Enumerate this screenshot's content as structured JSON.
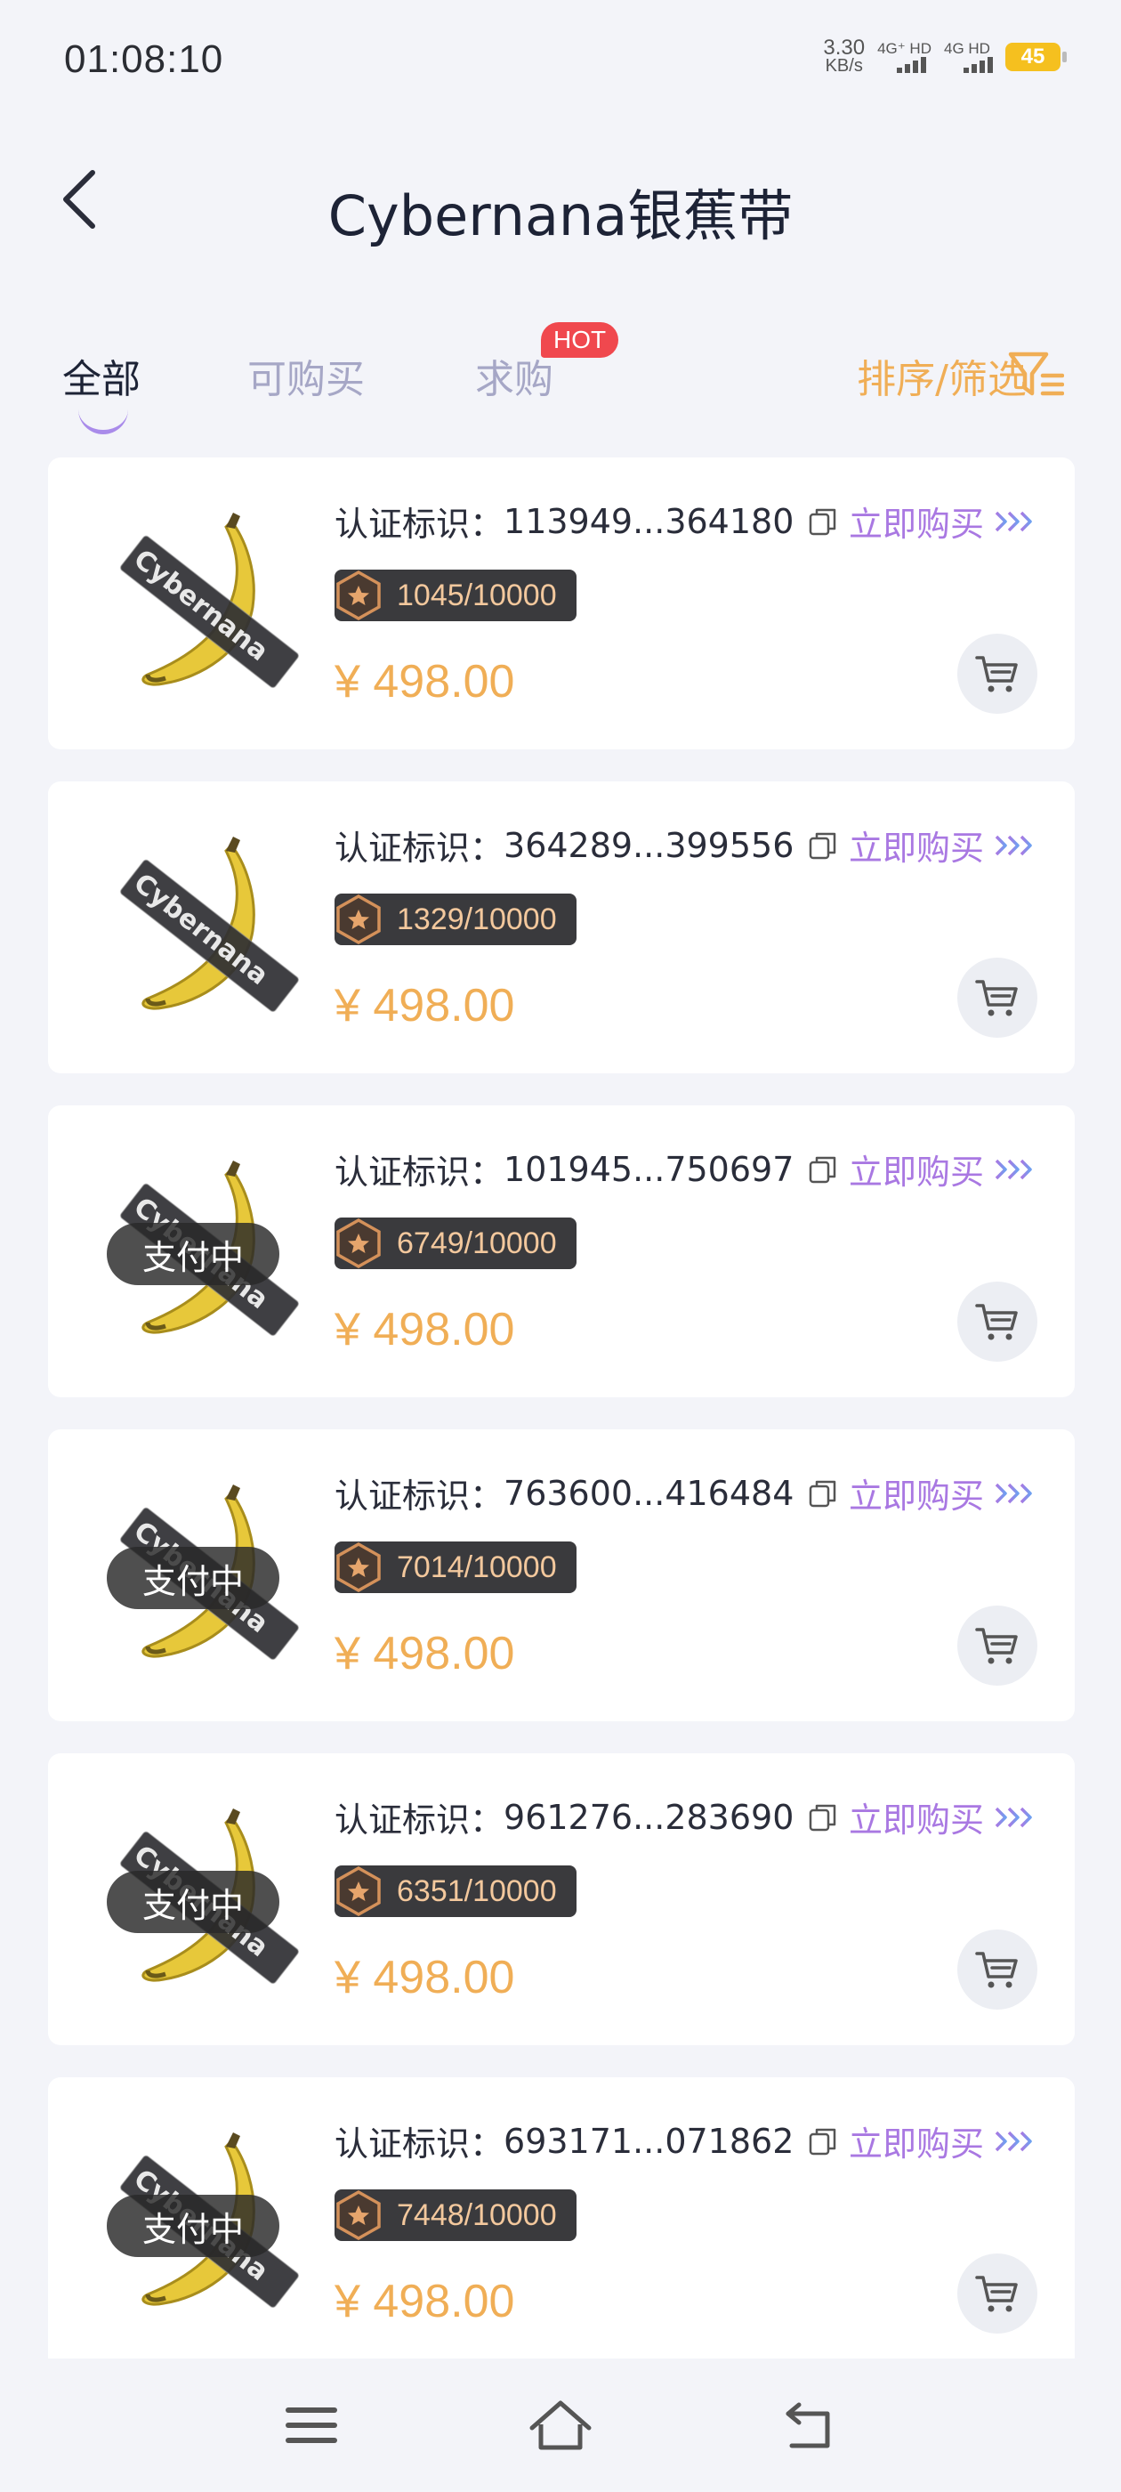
{
  "status_bar": {
    "time": "01:08:10",
    "net_speed_value": "3.30",
    "net_speed_unit": "KB/s",
    "sim1_label": "4G⁺ HD",
    "sim2_label": "4G HD",
    "battery": "45"
  },
  "header": {
    "title": "Cybernana银蕉带",
    "icons": {
      "back": "back-arrow-icon"
    }
  },
  "tabs": {
    "items": [
      {
        "label": "全部",
        "active": true
      },
      {
        "label": "可购买",
        "active": false
      },
      {
        "label": "求购",
        "active": false
      }
    ],
    "hot_badge": "HOT",
    "sort_filter_label": "排序/筛选"
  },
  "listings": [
    {
      "cert_label": "认证标识：",
      "cert_id": "113949...364180",
      "buy_label": "立即购买",
      "edition": "1045/10000",
      "price": "¥ 498.00",
      "status": ""
    },
    {
      "cert_label": "认证标识：",
      "cert_id": "364289...399556",
      "buy_label": "立即购买",
      "edition": "1329/10000",
      "price": "¥ 498.00",
      "status": ""
    },
    {
      "cert_label": "认证标识：",
      "cert_id": "101945...750697",
      "buy_label": "立即购买",
      "edition": "6749/10000",
      "price": "¥ 498.00",
      "status": "支付中"
    },
    {
      "cert_label": "认证标识：",
      "cert_id": "763600...416484",
      "buy_label": "立即购买",
      "edition": "7014/10000",
      "price": "¥ 498.00",
      "status": "支付中"
    },
    {
      "cert_label": "认证标识：",
      "cert_id": "961276...283690",
      "buy_label": "立即购买",
      "edition": "6351/10000",
      "price": "¥ 498.00",
      "status": "支付中"
    },
    {
      "cert_label": "认证标识：",
      "cert_id": "693171...071862",
      "buy_label": "立即购买",
      "edition": "7448/10000",
      "price": "¥ 498.00",
      "status": "支付中"
    }
  ],
  "colors": {
    "accent_orange": "#f0ae56",
    "accent_purple": "#a978e2",
    "hot_red": "#f0484e",
    "background": "#f3f4f9"
  }
}
